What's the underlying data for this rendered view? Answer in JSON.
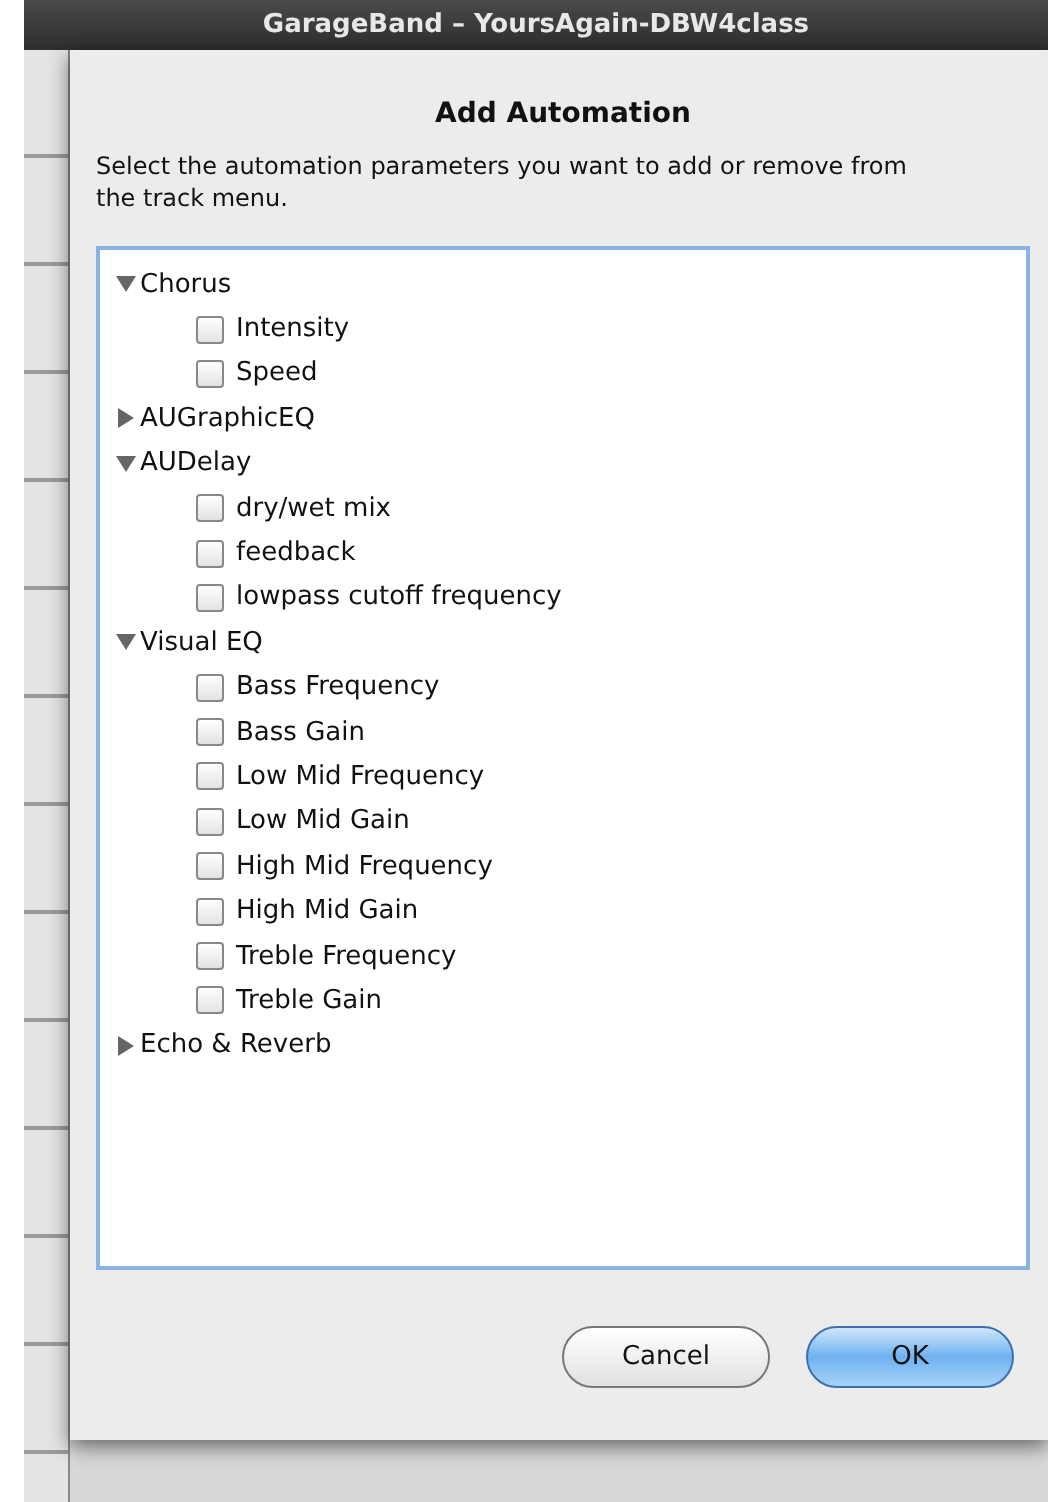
{
  "window": {
    "title": "GarageBand – YoursAgain-DBW4class"
  },
  "dialog": {
    "title": "Add Automation",
    "description": "Select the automation parameters you want to add or remove from the track menu.",
    "tree": [
      {
        "label": "Chorus",
        "expanded": true,
        "children": [
          {
            "label": "Intensity",
            "checked": false
          },
          {
            "label": "Speed",
            "checked": false
          }
        ]
      },
      {
        "label": "AUGraphicEQ",
        "expanded": false
      },
      {
        "label": "AUDelay",
        "expanded": true,
        "children": [
          {
            "label": "dry/wet mix",
            "checked": false
          },
          {
            "label": "feedback",
            "checked": false
          },
          {
            "label": "lowpass cutoff frequency",
            "checked": false
          }
        ]
      },
      {
        "label": "Visual EQ",
        "expanded": true,
        "children": [
          {
            "label": "Bass Frequency",
            "checked": false
          },
          {
            "label": "Bass Gain",
            "checked": false
          },
          {
            "label": "Low Mid Frequency",
            "checked": false
          },
          {
            "label": "Low Mid Gain",
            "checked": false
          },
          {
            "label": "High Mid Frequency",
            "checked": false
          },
          {
            "label": "High Mid Gain",
            "checked": false
          },
          {
            "label": "Treble Frequency",
            "checked": false
          },
          {
            "label": "Treble Gain",
            "checked": false
          }
        ]
      },
      {
        "label": "Echo & Reverb",
        "expanded": false
      }
    ],
    "buttons": [
      {
        "label": "Cancel",
        "default": false
      },
      {
        "label": "OK",
        "default": true
      }
    ]
  }
}
